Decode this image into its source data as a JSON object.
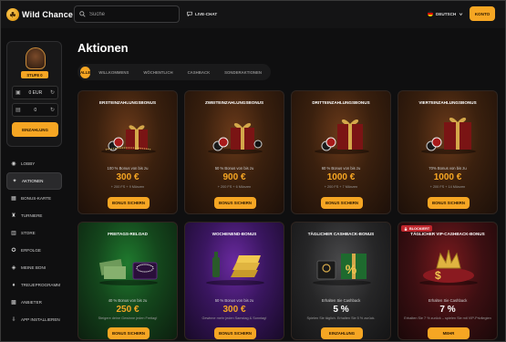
{
  "header": {
    "logo_text": "Wild Chance",
    "search_placeholder": "Suche",
    "live_chat": "LIVE-CHAT",
    "language": "DEUTSCH",
    "account_button": "KONTO"
  },
  "sidebar": {
    "level_label": "STUFE 0",
    "balance_real": "0 EUR",
    "balance_bonus": "0",
    "deposit_button": "EINZAHLUNG",
    "nav": [
      {
        "label": "LOBBY",
        "icon": "casino-icon"
      },
      {
        "label": "AKTIONEN",
        "icon": "gift-icon"
      },
      {
        "label": "BONUS-KARTE",
        "icon": "card-icon"
      },
      {
        "label": "TURNIERE",
        "icon": "trophy-icon"
      },
      {
        "label": "STORE",
        "icon": "store-icon"
      },
      {
        "label": "ERFOLGE",
        "icon": "medal-icon"
      },
      {
        "label": "MEINE BONI",
        "icon": "bonus-icon"
      },
      {
        "label": "TREUEPROGRAMM",
        "icon": "diamond-icon"
      },
      {
        "label": "ANBIETER",
        "icon": "provider-icon"
      },
      {
        "label": "APP INSTALLIEREN",
        "icon": "download-icon"
      }
    ],
    "active_index": 1
  },
  "main": {
    "title": "Aktionen",
    "tabs": [
      "ALLE",
      "WILLKOMMENS",
      "WÖCHENTLICH",
      "CASHBACK",
      "SONDERAKTIONEN"
    ],
    "active_tab": 0,
    "cards": [
      {
        "title": "ERSTEINZAHLUNGSBONUS",
        "desc": "100 % Bonus von bis zu",
        "amount": "300 €",
        "sub": "+ 200 FS + 9 Münzen",
        "button": "BONUS SICHERN",
        "theme": "brown"
      },
      {
        "title": "ZWEITEINZAHLUNGSBONUS",
        "desc": "50 % Bonus von bis zu",
        "amount": "900 €",
        "sub": "+ 200 FS + 6 Münzen",
        "button": "BONUS SICHERN",
        "theme": "brown"
      },
      {
        "title": "DRITTEINZAHLUNGSBONUS",
        "desc": "60 % Bonus von bis zu",
        "amount": "1000 €",
        "sub": "+ 200 FS + 7 Münzen",
        "button": "BONUS SICHERN",
        "theme": "brown"
      },
      {
        "title": "VIERTEINZAHLUNGSBONUS",
        "desc": "70% Bonus von bis zu",
        "amount": "1000 €",
        "sub": "+ 200 FS + 14 Münzen",
        "button": "BONUS SICHERN",
        "theme": "brown"
      },
      {
        "title": "FREITAGS-RELOAD",
        "desc": "40 % Bonus von bis zu",
        "amount": "250 €",
        "sub": "Steigere deine Gewinne jeden Freitag!",
        "button": "BONUS SICHERN",
        "theme": "green"
      },
      {
        "title": "WOCHENEND-BONUS",
        "desc": "50 % Bonus von bis zu",
        "amount": "300 €",
        "sub": "Gewinne mehr jeden Samstag & Sonntag!",
        "button": "BONUS SICHERN",
        "theme": "purple"
      },
      {
        "title": "TÄGLICHER CASHBACK-BONUS",
        "desc": "Erhalten Sie Cashback",
        "amount": "5 %",
        "sub": "Spielen Sie täglich. Erhalten Sie 5 % zurück.",
        "button": "EINZAHLUNG",
        "theme": "dark"
      },
      {
        "title": "TÄGLICHER VIP-CASHBACK-BONUS",
        "desc": "Erhalten Sie Cashback",
        "amount": "7 %",
        "sub": "Erhalten Sie 7 % zurück – spielen Sie mit VIP-Privilegien",
        "button": "MEHR",
        "theme": "red",
        "badge": "BLOCKIERT"
      }
    ]
  },
  "colors": {
    "accent": "#f6a623",
    "background": "#0f0f10",
    "badge_red": "#c0262c"
  }
}
